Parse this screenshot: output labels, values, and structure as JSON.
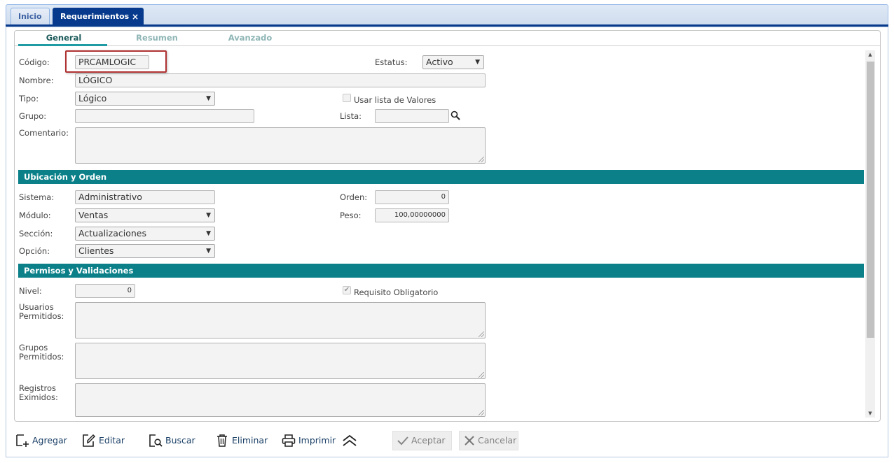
{
  "tabs": [
    {
      "label": "Inicio"
    },
    {
      "label": "Requerimientos",
      "close": "×"
    }
  ],
  "subtabs": [
    "General",
    "Resumen",
    "Avanzado"
  ],
  "form": {
    "codigo": {
      "label": "Código:",
      "value": "PRCAMLOGIC"
    },
    "estatus": {
      "label": "Estatus:",
      "value": "Activo"
    },
    "nombre": {
      "label": "Nombre:",
      "value": "LÓGICO"
    },
    "tipo": {
      "label": "Tipo:",
      "value": "Lógico"
    },
    "usar_lista": {
      "label": "Usar lista de Valores",
      "checked": false
    },
    "grupo": {
      "label": "Grupo:",
      "value": ""
    },
    "lista": {
      "label": "Lista:",
      "value": ""
    },
    "comentario": {
      "label": "Comentario:",
      "value": ""
    }
  },
  "ubicacion": {
    "title": "Ubicación y Orden",
    "sistema": {
      "label": "Sistema:",
      "value": "Administrativo"
    },
    "orden": {
      "label": "Orden:",
      "value": "0"
    },
    "modulo": {
      "label": "Módulo:",
      "value": "Ventas"
    },
    "peso": {
      "label": "Peso:",
      "value": "100,00000000"
    },
    "seccion": {
      "label": "Sección:",
      "value": "Actualizaciones"
    },
    "opcion": {
      "label": "Opción:",
      "value": "Clientes"
    }
  },
  "permisos": {
    "title": "Permisos y Validaciones",
    "nivel": {
      "label": "Nivel:",
      "value": "0"
    },
    "requisito": {
      "label": "Requisito Obligatorio",
      "checked": true
    },
    "usuarios": {
      "label1": "Usuarios",
      "label2": "Permitidos:"
    },
    "grupos": {
      "label1": "Grupos",
      "label2": "Permitidos:"
    },
    "registros": {
      "label1": "Registros",
      "label2": "Eximidos:"
    }
  },
  "toolbar": {
    "agregar": "Agregar",
    "editar": "Editar",
    "buscar": "Buscar",
    "eliminar": "Eliminar",
    "imprimir": "Imprimir",
    "aceptar": "Aceptar",
    "cancelar": "Cancelar"
  },
  "colors": {
    "accent": "#0b8089",
    "tab_active": "#073a8c",
    "highlight": "#b03232"
  }
}
